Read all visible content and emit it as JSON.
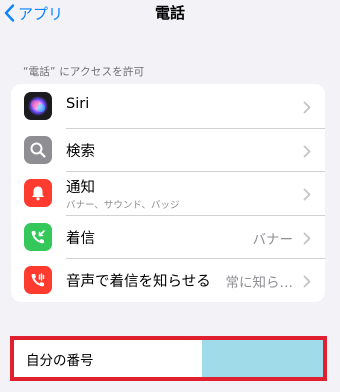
{
  "nav": {
    "back_label": "アプリ",
    "title": "電話"
  },
  "section_header": "“電話” にアクセスを許可",
  "rows": [
    {
      "label": "Siri",
      "icon": "siri-icon"
    },
    {
      "label": "検索",
      "icon": "search-icon",
      "icon_bg": "#8e8e93"
    },
    {
      "label": "通知",
      "sublabel": "バナー、サウンド、バッジ",
      "icon": "bell-icon",
      "icon_bg": "#ff3b30"
    },
    {
      "label": "着信",
      "value": "バナー",
      "icon": "incoming-call-icon",
      "icon_bg": "#34c759"
    },
    {
      "label": "音声で着信を知らせる",
      "value": "常に知ら…",
      "icon": "announce-call-icon",
      "icon_bg": "#ff3b30"
    }
  ],
  "my_number": {
    "label": "自分の番号"
  },
  "colors": {
    "accent": "#0a84ff",
    "highlight_border": "#e0202e",
    "highlight_fill": "#a0dbea"
  }
}
